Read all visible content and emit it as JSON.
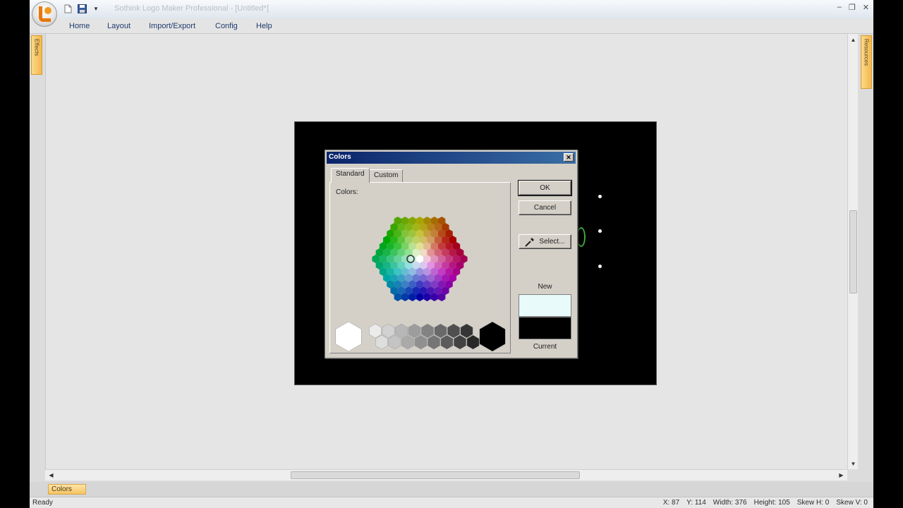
{
  "window": {
    "title": "Sothink Logo Maker Professional - [Untitled*]",
    "controls": [
      "–",
      "❐",
      "✕"
    ]
  },
  "menu": {
    "items": [
      "Home",
      "Layout",
      "Import/Export",
      "Config",
      "Help"
    ]
  },
  "side_tabs": {
    "left": "Effects",
    "right": "Resources"
  },
  "dialog": {
    "title": "Colors",
    "tabs": [
      "Standard",
      "Custom"
    ],
    "active_tab": "Standard",
    "colors_label": "Colors:",
    "ok_label": "OK",
    "cancel_label": "Cancel",
    "select_label": "Select...",
    "new_label": "New",
    "current_label": "Current",
    "new_color": "#e8fbfa",
    "current_color": "#000000"
  },
  "bottom_tab": {
    "label": "Colors"
  },
  "status": {
    "ready": "Ready",
    "x": "X: 87",
    "y": "Y: 114",
    "width": "Width: 376",
    "height": "Height: 105",
    "skew_h": "Skew H: 0",
    "skew_v": "Skew V: 0"
  },
  "icons": {
    "qat": [
      "new-file-icon",
      "save-icon",
      "dropdown-arrow-icon"
    ],
    "select": "eyedropper-icon"
  }
}
